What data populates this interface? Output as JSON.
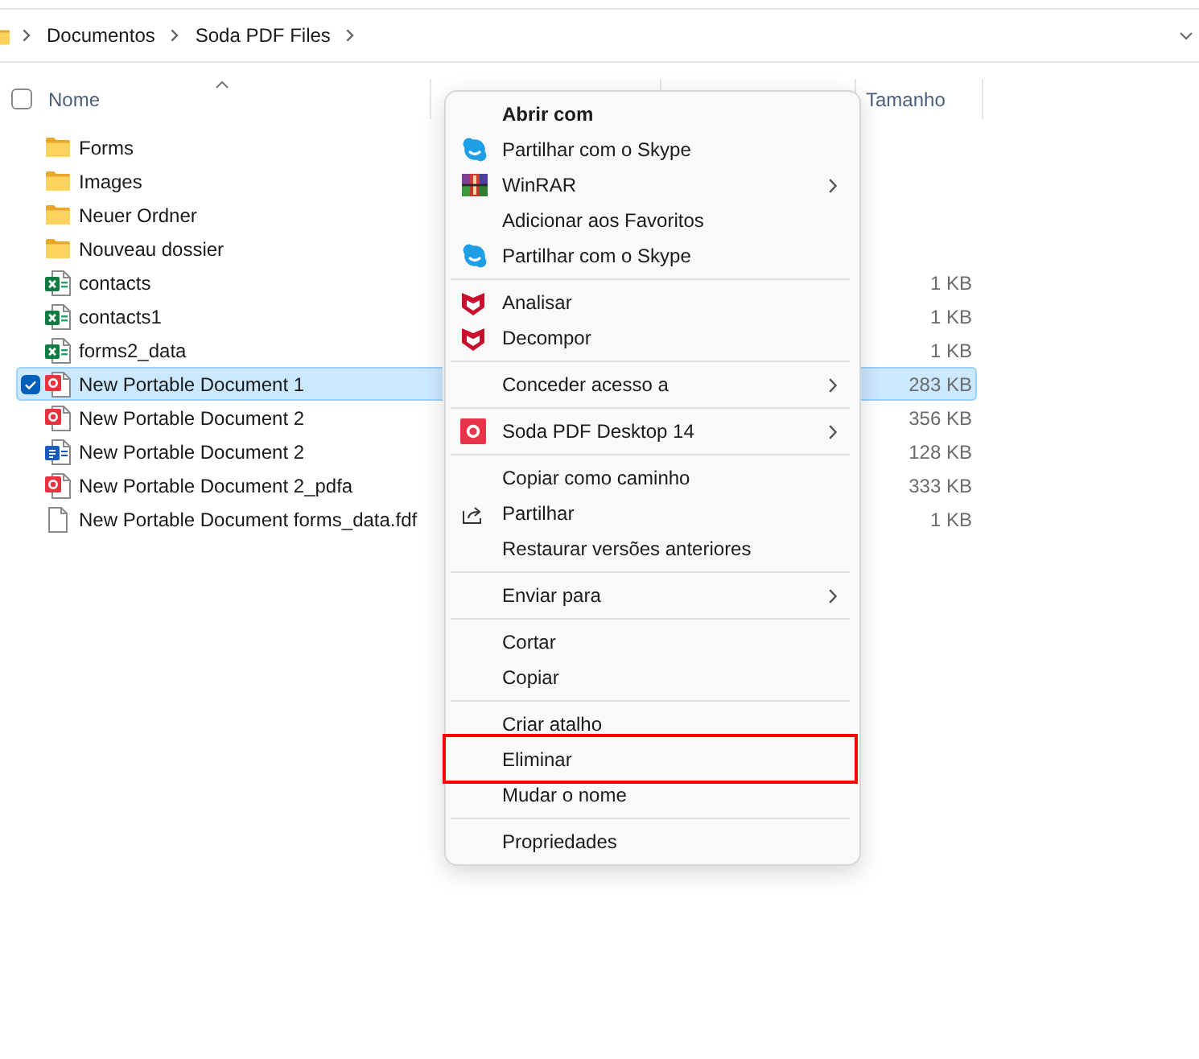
{
  "address_bar": {
    "breadcrumbs": [
      "Documentos",
      "Soda PDF Files"
    ]
  },
  "header_checkbox": {
    "checked": false
  },
  "columns": [
    {
      "label": "Nome",
      "sorted": true
    },
    {
      "label": "Tamanho",
      "sorted": false
    }
  ],
  "files": [
    {
      "name": "Forms",
      "kind": "folder",
      "selected": false
    },
    {
      "name": "Images",
      "kind": "folder",
      "selected": false
    },
    {
      "name": "Neuer Ordner",
      "kind": "folder",
      "selected": false
    },
    {
      "name": "Nouveau dossier",
      "kind": "folder",
      "selected": false
    },
    {
      "name": "contacts",
      "kind": "spreadsheet",
      "size": "1 KB",
      "selected": false
    },
    {
      "name": "contacts1",
      "kind": "spreadsheet",
      "size": "1 KB",
      "selected": false
    },
    {
      "name": "forms2_data",
      "kind": "spreadsheet",
      "size": "1 KB",
      "selected": false
    },
    {
      "name": "New Portable Document 1",
      "kind": "pdf",
      "size": "283 KB",
      "selected": true
    },
    {
      "name": "New Portable Document 2",
      "kind": "pdf",
      "size": "356 KB",
      "selected": false
    },
    {
      "name": "New Portable Document 2",
      "kind": "document",
      "size": "128 KB",
      "selected": false
    },
    {
      "name": "New Portable Document 2_pdfa",
      "kind": "pdf",
      "size": "333 KB",
      "selected": false
    },
    {
      "name": "New Portable Document forms_data.fdf",
      "kind": "file",
      "size": "1 KB",
      "selected": false
    }
  ],
  "context_menu": {
    "items": [
      {
        "kind": "plain",
        "label": "Abrir com",
        "default": true,
        "submenu": false,
        "highlighted": false
      },
      {
        "kind": "skype",
        "label": "Partilhar com o Skype",
        "default": false,
        "submenu": false,
        "highlighted": false
      },
      {
        "kind": "winrar",
        "label": "WinRAR",
        "default": false,
        "submenu": true,
        "highlighted": false
      },
      {
        "kind": "plain",
        "label": "Adicionar aos Favoritos",
        "default": false,
        "submenu": false,
        "highlighted": false
      },
      {
        "kind": "skype",
        "label": "Partilhar com o Skype",
        "default": false,
        "submenu": false,
        "highlighted": false
      },
      {
        "kind": "separator"
      },
      {
        "kind": "mcafee",
        "label": "Analisar",
        "default": false,
        "submenu": false,
        "highlighted": false
      },
      {
        "kind": "mcafee",
        "label": "Decompor",
        "default": false,
        "submenu": false,
        "highlighted": false
      },
      {
        "kind": "separator"
      },
      {
        "kind": "plain",
        "label": "Conceder acesso a",
        "default": false,
        "submenu": true,
        "highlighted": false
      },
      {
        "kind": "separator"
      },
      {
        "kind": "soda",
        "label": "Soda PDF Desktop 14",
        "default": false,
        "submenu": true,
        "highlighted": false
      },
      {
        "kind": "separator"
      },
      {
        "kind": "plain",
        "label": "Copiar como caminho",
        "default": false,
        "submenu": false,
        "highlighted": false
      },
      {
        "kind": "share",
        "label": "Partilhar",
        "default": false,
        "submenu": false,
        "highlighted": false
      },
      {
        "kind": "plain",
        "label": "Restaurar versões anteriores",
        "default": false,
        "submenu": false,
        "highlighted": false
      },
      {
        "kind": "separator"
      },
      {
        "kind": "plain",
        "label": "Enviar para",
        "default": false,
        "submenu": true,
        "highlighted": false
      },
      {
        "kind": "separator"
      },
      {
        "kind": "plain",
        "label": "Cortar",
        "default": false,
        "submenu": false,
        "highlighted": false
      },
      {
        "kind": "plain",
        "label": "Copiar",
        "default": false,
        "submenu": false,
        "highlighted": false
      },
      {
        "kind": "separator"
      },
      {
        "kind": "plain",
        "label": "Criar atalho",
        "default": false,
        "submenu": false,
        "highlighted": false
      },
      {
        "kind": "plain",
        "label": "Eliminar",
        "default": false,
        "submenu": false,
        "highlighted": true
      },
      {
        "kind": "plain",
        "label": "Mudar o nome",
        "default": false,
        "submenu": false,
        "highlighted": false
      },
      {
        "kind": "separator"
      },
      {
        "kind": "plain",
        "label": "Propriedades",
        "default": false,
        "submenu": false,
        "highlighted": false
      }
    ]
  }
}
